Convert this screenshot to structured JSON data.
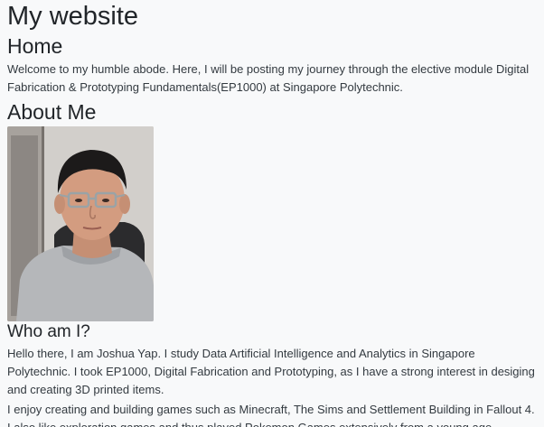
{
  "site": {
    "title": "My website"
  },
  "home": {
    "heading": "Home",
    "paragraph": "Welcome to my humble abode. Here, I will be posting my journey through the elective module Digital Fabrication & Prototyping Fundamentals(EP1000) at Singapore Polytechnic."
  },
  "about": {
    "heading": "About Me",
    "photo_alt": "Photo of Joshua Yap"
  },
  "who": {
    "heading": "Who am I?",
    "paragraph1": "Hello there, I am Joshua Yap. I study Data Artificial Intelligence and Analytics in Singapore Polytechnic. I took EP1000, Digital Fabrication and Prototyping, as I have a strong interest in desiging and creating 3D printed items.",
    "paragraph2": "I enjoy creating and building games such as Minecraft, The Sims and Settlement Building in Fallout 4. I also like exploration games and thus played Pokemon Games extensively from a young age."
  },
  "colors": {
    "background": "#f8f9fa",
    "text": "#212529"
  }
}
